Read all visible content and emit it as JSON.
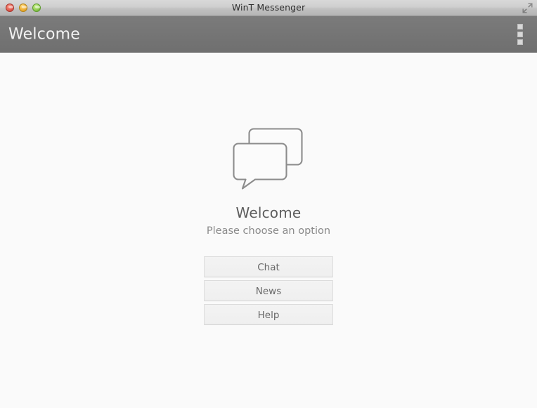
{
  "window": {
    "title": "WinT Messenger",
    "controls": {
      "close_label": "close-button",
      "minimize_label": "minimize-button",
      "zoom_label": "zoom-button",
      "fullscreen_label": "fullscreen-button"
    }
  },
  "header": {
    "title": "Welcome",
    "menu_label": "overflow-menu",
    "background_color": "#757575",
    "text_color": "#f2f2f2"
  },
  "main": {
    "icon_name": "chat-bubbles-icon",
    "heading": "Welcome",
    "subtitle": "Please choose an option",
    "buttons": [
      {
        "label": "Chat",
        "name": "chat-button"
      },
      {
        "label": "News",
        "name": "news-button"
      },
      {
        "label": "Help",
        "name": "help-button"
      }
    ]
  },
  "colors": {
    "page_background": "#fafafa",
    "heading_text": "#5d5d5d",
    "subtitle_text": "#8a8a8a",
    "button_text": "#686868",
    "button_border": "#dcdcdc",
    "icon_stroke": "#8c8c8c"
  }
}
